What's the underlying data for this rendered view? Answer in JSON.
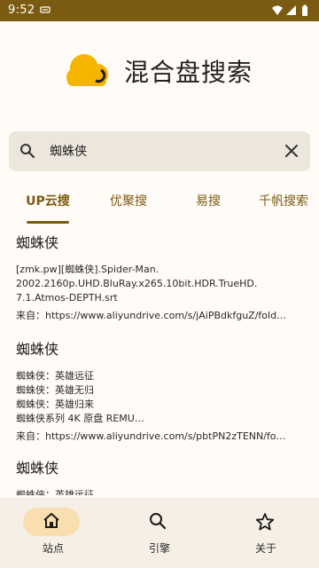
{
  "status_bar": {
    "time": "9:52",
    "notification_icon": "sim-card-icon",
    "icons": [
      "wifi-icon",
      "signal-icon",
      "battery-icon"
    ]
  },
  "header": {
    "title": "混合盘搜索",
    "logo_icon": "cloud-logo-icon"
  },
  "search": {
    "value": "蜘蛛侠",
    "icon": "search-icon",
    "clear_icon": "close-icon"
  },
  "tabs": [
    {
      "label": "UP云搜",
      "active": true
    },
    {
      "label": "优聚搜",
      "active": false
    },
    {
      "label": "易搜",
      "active": false
    },
    {
      "label": "千帆搜索",
      "active": false
    }
  ],
  "results": [
    {
      "title": "蜘蛛侠",
      "body": "[zmk.pw][蜘蛛侠].Spider-Man.\n2002.2160p.UHD.BluRay.x265.10bit.HDR.TrueHD.\n7.1.Atmos-DEPTH.srt",
      "source": "来自：https://www.aliyundrive.com/s/jAiPBdkfguZ/fold…"
    },
    {
      "title": "蜘蛛侠",
      "body": "蜘蛛侠：英雄远征\n蜘蛛侠：英雄无归\n蜘蛛侠：英雄归来\n蜘蛛侠系列 4K 原盘 REMU…",
      "source": "来自：https://www.aliyundrive.com/s/pbtPN2zTENN/fo…"
    },
    {
      "title": "蜘蛛侠",
      "body": "蜘蛛侠：英雄远征",
      "source": ""
    }
  ],
  "bottom_nav": [
    {
      "label": "站点",
      "icon": "home-icon",
      "active": true
    },
    {
      "label": "引擎",
      "icon": "search-icon",
      "active": false
    },
    {
      "label": "关于",
      "icon": "star-icon",
      "active": false
    }
  ],
  "colors": {
    "accent": "#7b5a12",
    "logo": "#f5b400",
    "active_pill": "#f9dfb0",
    "search_bg": "#ece6dd",
    "background": "#fffbf6",
    "nav_bg": "#f5efe6"
  }
}
